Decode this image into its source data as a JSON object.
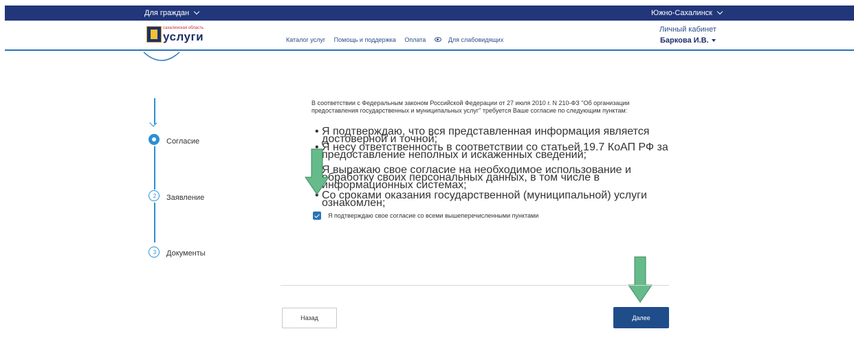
{
  "topbar": {
    "for_citizens": "Для граждан",
    "city": "Южно-Сахалинск"
  },
  "logo": {
    "region": "сахалинская область",
    "text": "услуги"
  },
  "nav": {
    "items": [
      "Каталог услуг",
      "Помощь и поддержка",
      "Оплата"
    ],
    "accessibility": "Для слабовидящих"
  },
  "account": {
    "cabinet_label": "Личный кабинет",
    "user_name": "Баркова И.В."
  },
  "steps": [
    {
      "number": "1",
      "label": "Согласие",
      "active": true
    },
    {
      "number": "2",
      "label": "Заявление",
      "active": false
    },
    {
      "number": "3",
      "label": "Документы",
      "active": false
    }
  ],
  "consent": {
    "intro": "В соответствии с Федеральным законом Российской Федерации от 27 июля 2010 г. N 210-ФЗ \"Об организации предоставления государственных и муниципальных услуг\" требуется Ваше согласие по следующим пунктам:",
    "items": [
      "Я подтверждаю, что вся представленная информация является достоверной и точной;",
      "Я несу ответственность в соответствии со статьей 19.7 КоАП РФ за предоставление неполных и искаженных сведений;",
      "Я выражаю свое согласие на необходимое использование и обработку своих персональных данных, в том числе в информационных системах;",
      "Со сроками оказания государственной (муниципальной) услуги ознакомлен;"
    ],
    "checkbox_label": "Я подтверждаю свое согласие со всеми вышеперечисленными пунктами",
    "checked": true
  },
  "buttons": {
    "back": "Назад",
    "next": "Далее"
  },
  "colors": {
    "topbar": "#22367a",
    "accent": "#2a90d4",
    "primary_button": "#1f4d8a",
    "hint_arrow": "#66bb8a"
  }
}
